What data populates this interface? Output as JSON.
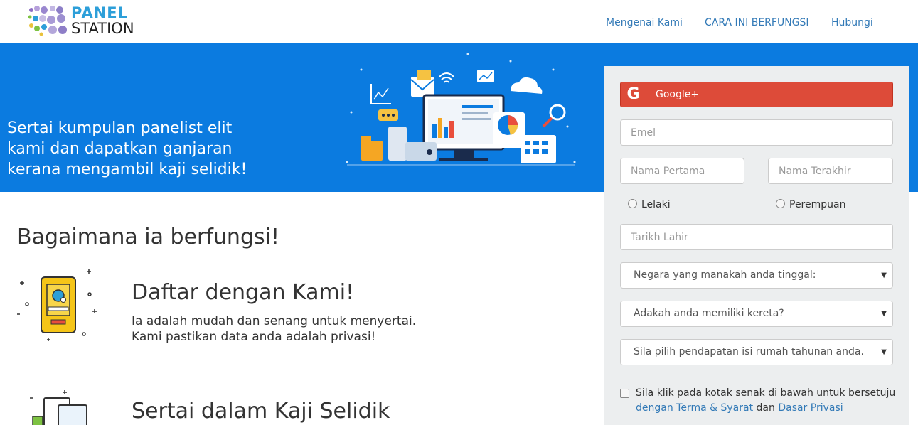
{
  "header": {
    "logo_line1": "PANEL",
    "logo_line2": "STATION",
    "nav": [
      {
        "label": "Mengenai Kami"
      },
      {
        "label": "CARA INI BERFUNGSI"
      },
      {
        "label": "Hubungi"
      }
    ]
  },
  "hero": {
    "tagline_1": "Sertai kumpulan panelist elit",
    "tagline_2": "kami dan dapatkan ganjaran",
    "tagline_3": "kerana mengambil kaji selidik!"
  },
  "form": {
    "google_label": "Google+",
    "email_placeholder": "Emel",
    "first_name_placeholder": "Nama Pertama",
    "last_name_placeholder": "Nama Terakhir",
    "gender_male": "Lelaki",
    "gender_female": "Perempuan",
    "dob_placeholder": "Tarikh Lahir",
    "country_select": "Negara yang manakah anda tinggal:",
    "car_select": "Adakah anda memiliki kereta?",
    "income_select": "Sila pilih pendapatan isi rumah tahunan anda.",
    "agree_text": "Sila klik pada kotak senak di bawah untuk bersetuju",
    "agree_link_terms": "dengan Terma & Syarat",
    "agree_and": "dan",
    "agree_link_privacy": "Dasar Privasi"
  },
  "how": {
    "title": "Bagaimana ia berfungsi!",
    "steps": [
      {
        "title": "Daftar dengan Kami!",
        "desc_1": "Ia adalah mudah dan senang untuk menyertai.",
        "desc_2": "Kami pastikan data anda adalah privasi!"
      },
      {
        "title": "Sertai dalam Kaji Selidik"
      }
    ]
  },
  "colors": {
    "hero_blue": "#0b7be0",
    "google_red": "#dd4b39",
    "link_blue": "#337ab7"
  }
}
